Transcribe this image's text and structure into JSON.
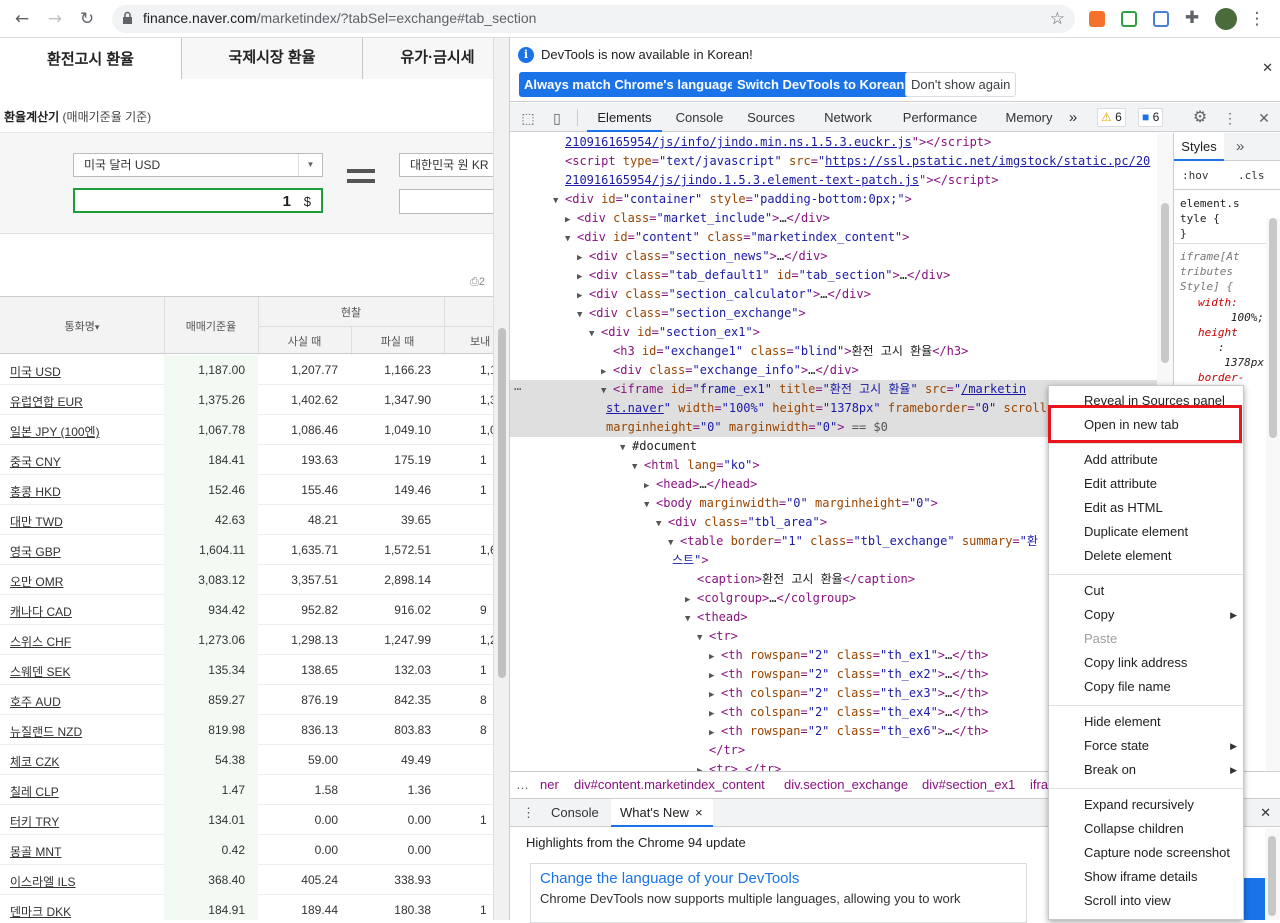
{
  "browser": {
    "url_main": "finance.naver.com",
    "url_rest": "/marketindex/?tabSel=exchange#tab_section"
  },
  "page": {
    "tabs": [
      "환전고시 환율",
      "국제시장 환율",
      "유가·금시세"
    ],
    "calc_title": "환율계산기",
    "calc_subtitle": "(매매기준율 기준)",
    "from_currency": "미국 달러 USD",
    "to_currency": "대한민국 원 KR",
    "amount": "1",
    "amount_unit": "$",
    "small_marker": "2",
    "table_headers": {
      "name": "통화명",
      "name_sort": "▾",
      "base": "매매기준율",
      "cash": "현찰",
      "buy": "사실 때",
      "sell": "파실 때",
      "send": "보내"
    },
    "rows": [
      {
        "name": "미국 USD",
        "base": "1,187.00",
        "buy": "1,207.77",
        "sell": "1,166.23",
        "send": "1,1"
      },
      {
        "name": "유럽연합 EUR",
        "base": "1,375.26",
        "buy": "1,402.62",
        "sell": "1,347.90",
        "send": "1,3"
      },
      {
        "name": "일본 JPY (100엔)",
        "base": "1,067.78",
        "buy": "1,086.46",
        "sell": "1,049.10",
        "send": "1,0"
      },
      {
        "name": "중국 CNY",
        "base": "184.41",
        "buy": "193.63",
        "sell": "175.19",
        "send": "1"
      },
      {
        "name": "홍콩 HKD",
        "base": "152.46",
        "buy": "155.46",
        "sell": "149.46",
        "send": "1"
      },
      {
        "name": "대만 TWD",
        "base": "42.63",
        "buy": "48.21",
        "sell": "39.65",
        "send": ""
      },
      {
        "name": "영국 GBP",
        "base": "1,604.11",
        "buy": "1,635.71",
        "sell": "1,572.51",
        "send": "1,6"
      },
      {
        "name": "오만 OMR",
        "base": "3,083.12",
        "buy": "3,357.51",
        "sell": "2,898.14",
        "send": ""
      },
      {
        "name": "캐나다 CAD",
        "base": "934.42",
        "buy": "952.82",
        "sell": "916.02",
        "send": "9"
      },
      {
        "name": "스위스 CHF",
        "base": "1,273.06",
        "buy": "1,298.13",
        "sell": "1,247.99",
        "send": "1,2"
      },
      {
        "name": "스웨덴 SEK",
        "base": "135.34",
        "buy": "138.65",
        "sell": "132.03",
        "send": "1"
      },
      {
        "name": "호주 AUD",
        "base": "859.27",
        "buy": "876.19",
        "sell": "842.35",
        "send": "8"
      },
      {
        "name": "뉴질랜드 NZD",
        "base": "819.98",
        "buy": "836.13",
        "sell": "803.83",
        "send": "8"
      },
      {
        "name": "체코 CZK",
        "base": "54.38",
        "buy": "59.00",
        "sell": "49.49",
        "send": ""
      },
      {
        "name": "칠레 CLP",
        "base": "1.47",
        "buy": "1.58",
        "sell": "1.36",
        "send": ""
      },
      {
        "name": "터키 TRY",
        "base": "134.01",
        "buy": "0.00",
        "sell": "0.00",
        "send": "1"
      },
      {
        "name": "몽골 MNT",
        "base": "0.42",
        "buy": "0.00",
        "sell": "0.00",
        "send": ""
      },
      {
        "name": "이스라엘 ILS",
        "base": "368.40",
        "buy": "405.24",
        "sell": "338.93",
        "send": ""
      },
      {
        "name": "덴마크 DKK",
        "base": "184.91",
        "buy": "189.44",
        "sell": "180.38",
        "send": "1"
      }
    ]
  },
  "devtools": {
    "info_message": "DevTools is now available in Korean!",
    "btn_match": "Always match Chrome's language",
    "btn_switch": "Switch DevTools to Korean",
    "btn_dont": "Don't show again",
    "tabs": [
      "Elements",
      "Console",
      "Sources",
      "Network",
      "Performance",
      "Memory"
    ],
    "more_tabs": "»",
    "warn_count": "6",
    "msg_count": "6",
    "styles_tab": "Styles",
    "styles_more": "»",
    "filter_hov": ":hov",
    "filter_cls": ".cls",
    "styles_lines": [
      "element.s",
      "tyle {",
      "}"
    ],
    "styles_attr": [
      "iframe[At",
      "tributes",
      "Style] {"
    ],
    "styles_props": [
      "width:",
      "100%;",
      "height",
      ":",
      "1378px",
      "border-"
    ],
    "breadcrumb": [
      "ner",
      "div#content.marketindex_content",
      "div.section_exchange",
      "div#section_ex1",
      "ifra"
    ],
    "drawer_tabs": [
      "Console",
      "What's New"
    ],
    "drawer_close": "×",
    "whatsnew_highlight": "Highlights from the Chrome 94 update",
    "whatsnew_card_title": "Change the language of your DevTools",
    "whatsnew_card_text": "Chrome DevTools now supports multiple languages, allowing you to work"
  },
  "context_menu": {
    "items": [
      {
        "label": "Reveal in Sources panel",
        "disabled": false,
        "sub": false
      },
      {
        "label": "Open in new tab",
        "disabled": false,
        "sub": false
      },
      {
        "label": "Add attribute",
        "disabled": false,
        "sub": false
      },
      {
        "label": "Edit attribute",
        "disabled": false,
        "sub": false
      },
      {
        "label": "Edit as HTML",
        "disabled": false,
        "sub": false
      },
      {
        "label": "Duplicate element",
        "disabled": false,
        "sub": false
      },
      {
        "label": "Delete element",
        "disabled": false,
        "sub": false
      },
      {
        "label": "Cut",
        "disabled": false,
        "sub": false
      },
      {
        "label": "Copy",
        "disabled": false,
        "sub": true
      },
      {
        "label": "Paste",
        "disabled": true,
        "sub": false
      },
      {
        "label": "Copy link address",
        "disabled": false,
        "sub": false
      },
      {
        "label": "Copy file name",
        "disabled": false,
        "sub": false
      },
      {
        "label": "Hide element",
        "disabled": false,
        "sub": false
      },
      {
        "label": "Force state",
        "disabled": false,
        "sub": true
      },
      {
        "label": "Break on",
        "disabled": false,
        "sub": true
      },
      {
        "label": "Expand recursively",
        "disabled": false,
        "sub": false
      },
      {
        "label": "Collapse children",
        "disabled": false,
        "sub": false
      },
      {
        "label": "Capture node screenshot",
        "disabled": false,
        "sub": false
      },
      {
        "label": "Show iframe details",
        "disabled": false,
        "sub": false
      },
      {
        "label": "Scroll into view",
        "disabled": false,
        "sub": false
      }
    ]
  },
  "colors": {
    "accent": "#1a73e8",
    "highlight": "#e8151c",
    "green_input": "#1f9d3a"
  }
}
